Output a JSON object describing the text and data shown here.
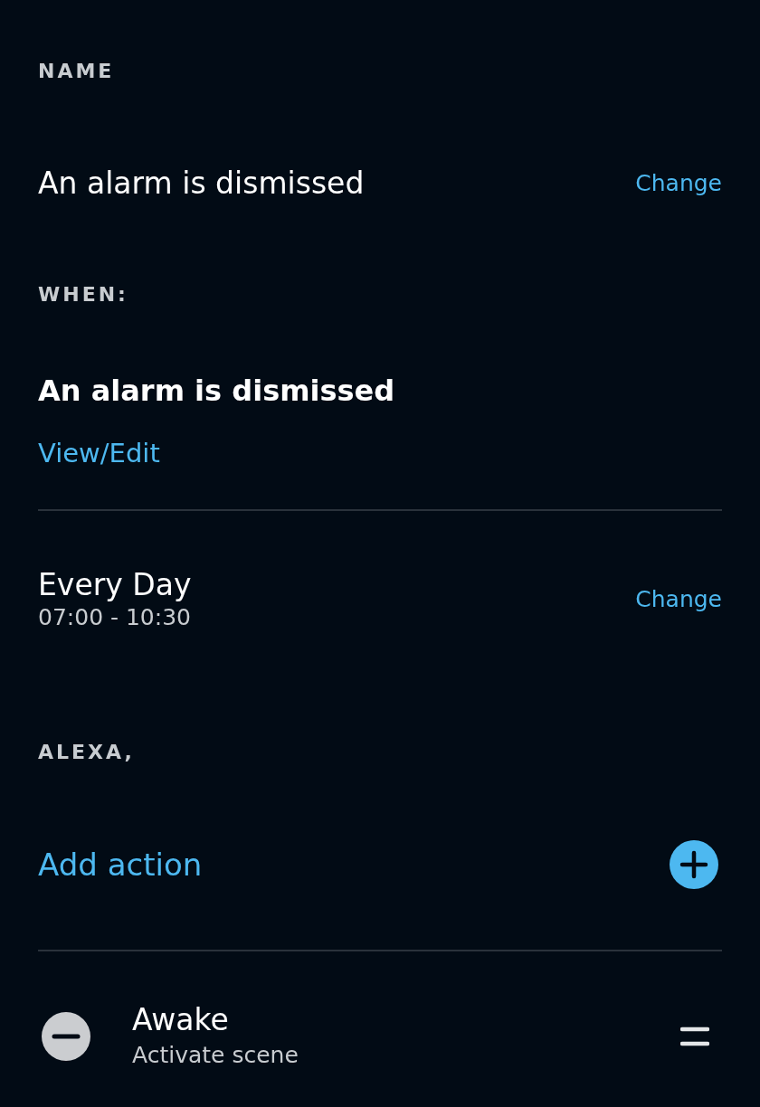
{
  "name_section": {
    "label": "NAME",
    "value": "An alarm is dismissed",
    "change": "Change"
  },
  "when_section": {
    "label": "WHEN:",
    "trigger": "An alarm is dismissed",
    "link": "View/Edit"
  },
  "schedule": {
    "days": "Every Day",
    "time": "07:00 - 10:30",
    "change": "Change"
  },
  "actions_section": {
    "label": "ALEXA,",
    "add": "Add action",
    "actions": [
      {
        "title": "Awake",
        "subtitle": "Activate scene"
      }
    ]
  }
}
